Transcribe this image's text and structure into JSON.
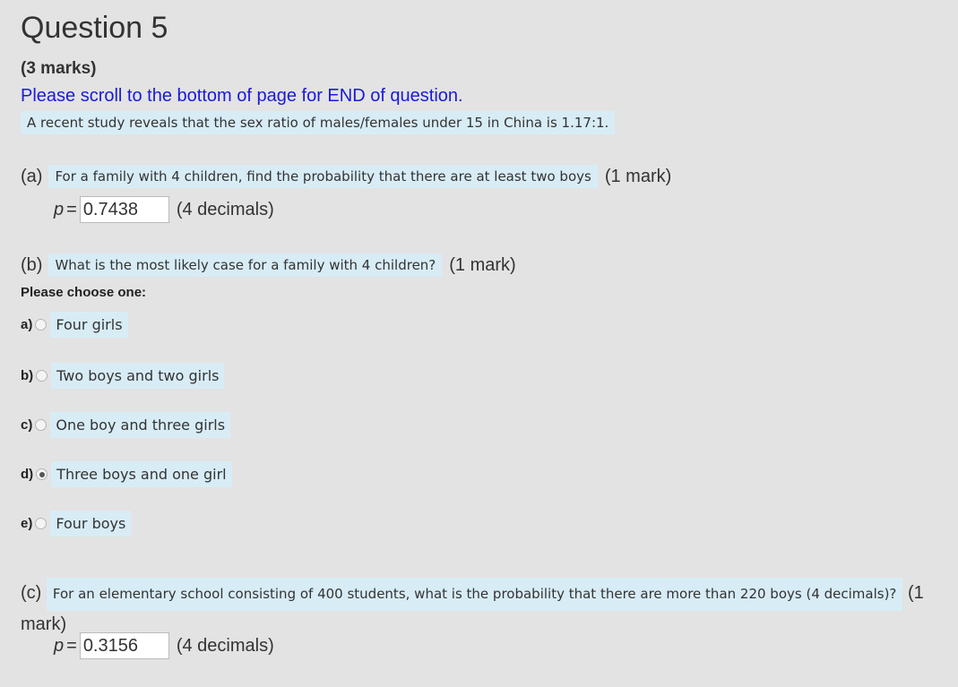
{
  "question": {
    "title": "Question 5",
    "marks": "(3 marks)",
    "scroll_note": "Please scroll to the bottom of page for END of question.",
    "intro": "A recent study reveals that the sex ratio of males/females under 15 in China is 1.17:1."
  },
  "part_a": {
    "letter": "(a)",
    "text": "For a family with 4 children, find the probability that there are at least two boys",
    "mark": "(1 mark)",
    "p_label": "p",
    "equals": "=",
    "value": "0.7438",
    "hint": "(4 decimals)"
  },
  "part_b": {
    "letter": "(b)",
    "text": "What is the most likely case for a family with 4 children?",
    "mark": "(1 mark)",
    "choose_label": "Please choose one:",
    "selected": "d",
    "options": [
      {
        "letter": "a)",
        "label": "Four girls",
        "checked": false
      },
      {
        "letter": "b)",
        "label": "Two boys and two girls",
        "checked": false
      },
      {
        "letter": "c)",
        "label": "One boy and three girls",
        "checked": false
      },
      {
        "letter": "d)",
        "label": "Three boys and one girl",
        "checked": true
      },
      {
        "letter": "e)",
        "label": "Four boys",
        "checked": false
      }
    ]
  },
  "part_c": {
    "letter": "(c)",
    "text": "For an elementary school consisting of 400 students, what is the probability that there are more than 220 boys (4 decimals)?",
    "mark": "(1 mark)",
    "p_label": "p",
    "equals": "=",
    "value": "0.3156",
    "hint": "(4 decimals)"
  },
  "colors": {
    "background": "#e3e3e3",
    "highlight": "#d8ecf6",
    "link_blue": "#1a1ad8"
  }
}
